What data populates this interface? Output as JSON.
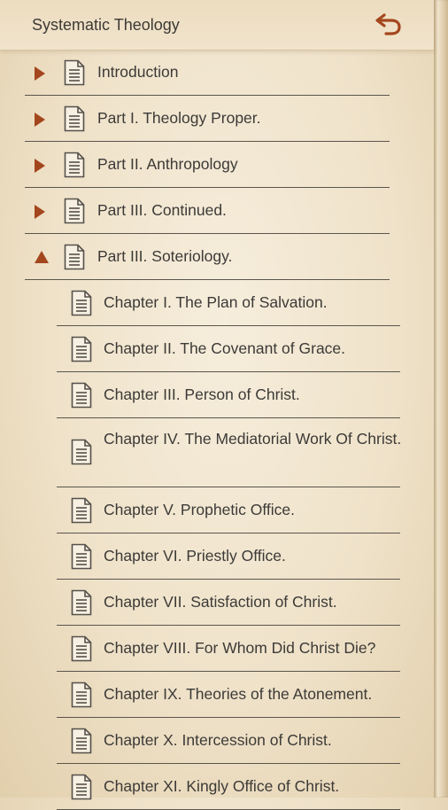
{
  "header": {
    "title": "Systematic Theology",
    "back_icon": "undo-arrow-icon"
  },
  "colors": {
    "accent": "#a4461d",
    "divider": "#5a554c",
    "text": "#3c3a37"
  },
  "parts": [
    {
      "label": "Introduction",
      "expanded": false
    },
    {
      "label": "Part I. Theology Proper.",
      "expanded": false
    },
    {
      "label": "Part II. Anthropology",
      "expanded": false
    },
    {
      "label": "Part III. Continued.",
      "expanded": false
    },
    {
      "label": "Part III. Soteriology.",
      "expanded": true
    }
  ],
  "chapters": [
    "Chapter I. The Plan of Salvation.",
    "Chapter II. The Covenant of Grace.",
    "Chapter III. Person of Christ.",
    "Chapter IV. The Mediatorial Work Of Christ.",
    "Chapter V. Prophetic Office.",
    "Chapter VI. Priestly Office.",
    "Chapter VII. Satisfaction of Christ.",
    "Chapter VIII. For Whom Did Christ Die?",
    "Chapter IX. Theories of the Atonement.",
    "Chapter X. Intercession of Christ.",
    "Chapter XI. Kingly Office of Christ."
  ]
}
